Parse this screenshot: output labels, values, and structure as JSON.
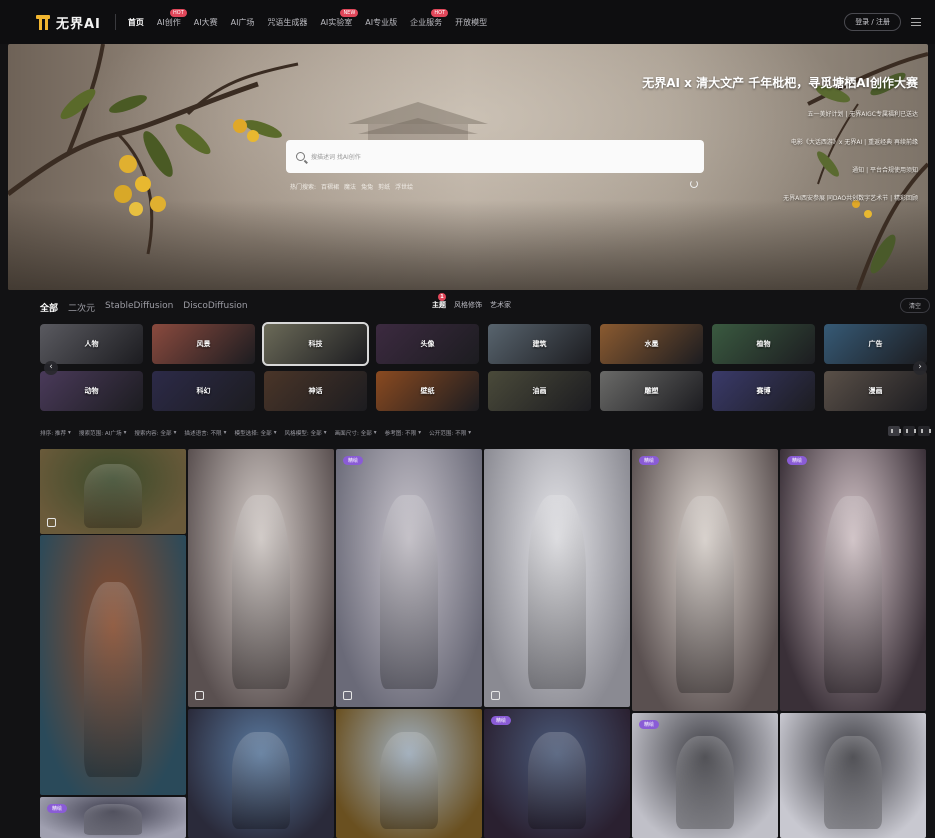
{
  "nav": {
    "logo_text": "无界AI",
    "items": [
      {
        "label": "首页",
        "active": true,
        "badge": ""
      },
      {
        "label": "AI创作",
        "active": false,
        "badge": "HOT"
      },
      {
        "label": "AI大赛",
        "active": false,
        "badge": ""
      },
      {
        "label": "AI广场",
        "active": false,
        "badge": ""
      },
      {
        "label": "咒语生成器",
        "active": false,
        "badge": ""
      },
      {
        "label": "AI实验室",
        "active": false,
        "badge": "NEW"
      },
      {
        "label": "AI专业版",
        "active": false,
        "badge": ""
      },
      {
        "label": "企业服务",
        "active": false,
        "badge": "HOT"
      },
      {
        "label": "开放模型",
        "active": false,
        "badge": ""
      }
    ],
    "login_label": "登录 / 注册"
  },
  "hero": {
    "search_placeholder": "搜描述词 找AI创作",
    "hot_label": "热门搜索:",
    "hot_terms": [
      "百褶裙",
      "魔法",
      "兔兔",
      "剪纸",
      "浮世绘"
    ],
    "title": "无界AI x 清大文产 千年枇杷，寻觅塘栖AI创作大赛",
    "lines": [
      "五一美好计划 | 无界AIGC专属福利已送达",
      "电影《大话西游》x 无界AI | 重返经典 再续前缘",
      "通知 | 平台合规使用须知",
      "无界AI西安参展 同DAO共创数字艺术节 | 精彩回顾"
    ],
    "colors": {
      "search_bg": "#fafafa",
      "title": "#ffffff"
    }
  },
  "filters": {
    "tabs": [
      {
        "label": "全部",
        "active": true
      },
      {
        "label": "二次元",
        "active": false
      },
      {
        "label": "StableDiffusion",
        "active": false
      },
      {
        "label": "DiscoDiffusion",
        "active": false
      }
    ],
    "center_tabs": [
      {
        "label": "主题",
        "active": true,
        "badge": "1"
      },
      {
        "label": "风格修饰",
        "active": false,
        "badge": ""
      },
      {
        "label": "艺术家",
        "active": false,
        "badge": ""
      }
    ],
    "clear_label": "清空"
  },
  "categories": [
    {
      "label": "人物",
      "color": "#5a5a60",
      "selected": false
    },
    {
      "label": "风景",
      "color": "#8a4a3e",
      "selected": false
    },
    {
      "label": "科技",
      "color": "#6b6a58",
      "selected": true
    },
    {
      "label": "头像",
      "color": "#3c2a40",
      "selected": false
    },
    {
      "label": "建筑",
      "color": "#58646e",
      "selected": false
    },
    {
      "label": "水墨",
      "color": "#8a5a30",
      "selected": false
    },
    {
      "label": "植物",
      "color": "#3a5a40",
      "selected": false
    },
    {
      "label": "广告",
      "color": "#365a76",
      "selected": false
    },
    {
      "label": "动物",
      "color": "#4a3a5a",
      "selected": false
    },
    {
      "label": "科幻",
      "color": "#2c2a48",
      "selected": false
    },
    {
      "label": "神话",
      "color": "#4a3528",
      "selected": false
    },
    {
      "label": "壁纸",
      "color": "#8a4a20",
      "selected": false
    },
    {
      "label": "油画",
      "color": "#4a4a3a",
      "selected": false
    },
    {
      "label": "雕塑",
      "color": "#6a6a68",
      "selected": false
    },
    {
      "label": "赛博",
      "color": "#3a3a6a",
      "selected": false
    },
    {
      "label": "漫画",
      "color": "#5a5048",
      "selected": false
    }
  ],
  "options": [
    "排序: 推荐",
    "搜索范围: AI广场",
    "搜索内容: 全部",
    "描述语言: 不限",
    "模型选择: 全部",
    "风格模型: 全部",
    "画面尺寸: 全部",
    "参考图: 不限",
    "公开范围: 不限"
  ],
  "gallery": {
    "badge_label": "精绘",
    "cards": [
      {
        "name": "boy-portrait",
        "colors": [
          "#3a4a2a",
          "#6a5a3a"
        ],
        "badge": false,
        "icon": true
      },
      {
        "name": "mecha-warrior",
        "colors": [
          "#8a4a2a",
          "#2a4a5a"
        ],
        "badge": false,
        "icon": false
      },
      {
        "name": "pink-hair-girl",
        "colors": [
          "#d8d0cc",
          "#5a5050"
        ],
        "badge": false,
        "icon": true
      },
      {
        "name": "white-goddess",
        "colors": [
          "#c8c4cc",
          "#6a6a78"
        ],
        "badge": true,
        "icon": true
      },
      {
        "name": "abstract-white",
        "colors": [
          "#e6e6ea",
          "#8a8a92"
        ],
        "badge": false,
        "icon": true
      },
      {
        "name": "empress-bride",
        "colors": [
          "#e0d8d2",
          "#5a5050"
        ],
        "badge": true,
        "icon": false
      },
      {
        "name": "dark-hair-princess",
        "colors": [
          "#d8c8cc",
          "#3a3038"
        ],
        "badge": true,
        "icon": false
      },
      {
        "name": "white-mecha-girl",
        "colors": [
          "#3a3a4a",
          "#a0a0b0"
        ],
        "badge": true,
        "icon": false
      },
      {
        "name": "blue-armor-girl",
        "colors": [
          "#5a7aa0",
          "#2a2a3a"
        ],
        "badge": false,
        "icon": false
      },
      {
        "name": "yellow-robot",
        "colors": [
          "#a0b0c0",
          "#6a5020"
        ],
        "badge": false,
        "icon": false
      },
      {
        "name": "anime-fighter",
        "colors": [
          "#4a5a7a",
          "#2a2030"
        ],
        "badge": true,
        "icon": false
      },
      {
        "name": "white-robot-a",
        "colors": [
          "#3a3a40",
          "#c0c0c8"
        ],
        "badge": true,
        "icon": false
      },
      {
        "name": "white-robot-b",
        "colors": [
          "#3a3a40",
          "#c8c8d0"
        ],
        "badge": false,
        "icon": false
      }
    ]
  }
}
